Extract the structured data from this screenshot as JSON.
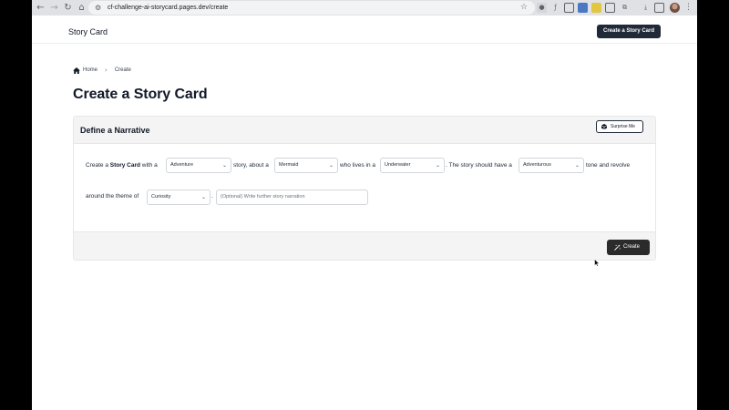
{
  "browser": {
    "url": "cf-challenge-ai-storycard.pages.dev/create",
    "icons": [
      "back-icon",
      "forward-icon",
      "reload-icon",
      "home-icon",
      "tune-icon",
      "bookmark-star-icon",
      "extensions-icon",
      "download-icon",
      "profile-avatar",
      "menu-icon"
    ]
  },
  "header": {
    "brand": "Story Card",
    "cta_label": "Create a Story Card"
  },
  "breadcrumb": {
    "home_label": "Home",
    "current_label": "Create"
  },
  "page": {
    "title": "Create a Story Card"
  },
  "card": {
    "title": "Define a Narrative",
    "surprise_label": "Surprise Me",
    "create_label": "Create"
  },
  "sentence": {
    "t1": "Create a ",
    "t1_bold": "Story Card",
    "t1_end": " with a",
    "t2": "story, about a",
    "t3": "who lives in a",
    "t4": ". The story should have a",
    "t5": "tone and revolve",
    "t6": "around the theme of",
    "t7": "."
  },
  "fields": {
    "genre": "Adventure",
    "character": "Mermaid",
    "setting": "Underwater",
    "tone": "Adventurous",
    "theme": "Curiosity",
    "narration_placeholder": "(Optional) Write further story narration"
  },
  "colors": {
    "dark_button": "#1f2937",
    "panel_bg": "#f3f4f3"
  }
}
